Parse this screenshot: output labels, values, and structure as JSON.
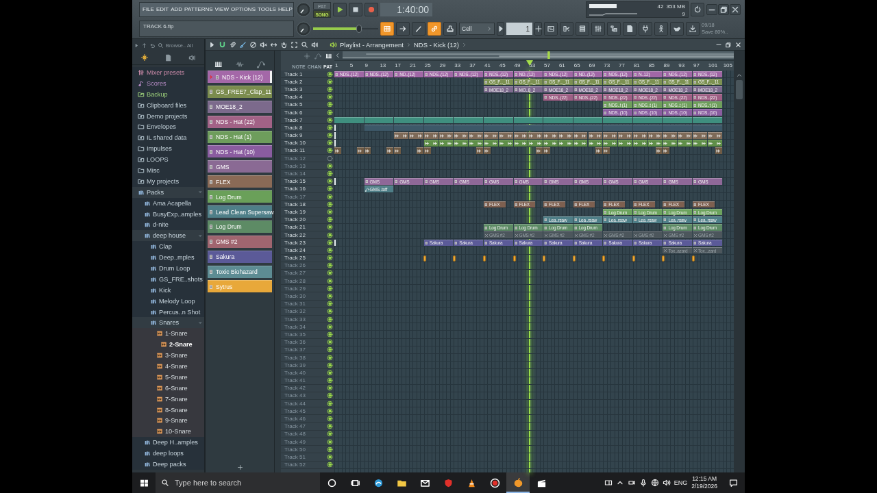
{
  "toolbar": {
    "menus": [
      "FILE",
      "EDIT",
      "ADD",
      "PATTERNS",
      "VIEW",
      "OPTIONS",
      "TOOLS",
      "HELP"
    ],
    "hint": "TRACK 6.flp",
    "modes": [
      {
        "label": "PAT",
        "selected": false
      },
      {
        "label": "SONG",
        "selected": true
      }
    ],
    "time": "1:40:00",
    "cpu": "42",
    "memory": "353 MB",
    "polyphony": "9",
    "master_volume": {
      "level": 0.7
    },
    "tools": [
      {
        "kind": "pattern",
        "on": true
      },
      {
        "kind": "arrow",
        "on": false
      },
      {
        "kind": "pen",
        "on": false
      },
      {
        "kind": "link",
        "on": true
      },
      {
        "kind": "stamp",
        "on": false
      }
    ],
    "snap": "Cell",
    "pattern": "1",
    "news": {
      "date": "09/18",
      "text": "Save 80%.."
    }
  },
  "browser": {
    "filter": "Browse.. All",
    "items": [
      {
        "label": "Mixer presets",
        "kind": "mixer",
        "selected": false
      },
      {
        "label": "Scores",
        "kind": "score",
        "selected": false
      },
      {
        "label": "Backup",
        "kind": "backup",
        "selected": false
      },
      {
        "label": "Clipboard files",
        "kind": "link-folder",
        "selected": false
      },
      {
        "label": "Demo projects",
        "kind": "link-folder",
        "selected": false
      },
      {
        "label": "Envelopes",
        "kind": "folder",
        "selected": false
      },
      {
        "label": "IL shared data",
        "kind": "link-folder",
        "selected": false
      },
      {
        "label": "Impulses",
        "kind": "folder",
        "selected": false
      },
      {
        "label": "LOOPS",
        "kind": "link-folder",
        "selected": false
      },
      {
        "label": "Misc",
        "kind": "folder",
        "selected": false
      },
      {
        "label": "My projects",
        "kind": "link-folder",
        "selected": false
      },
      {
        "label": "Packs",
        "kind": "pack",
        "selected": false,
        "expanded": true,
        "children": [
          {
            "label": "Ama Acapella",
            "kind": "pack",
            "selected": false
          },
          {
            "label": "BusyExp..amples",
            "kind": "pack",
            "selected": false
          },
          {
            "label": "d-nite",
            "kind": "pack",
            "selected": false
          },
          {
            "label": "deep house",
            "kind": "pack",
            "selected": false,
            "expanded": true,
            "children": [
              {
                "label": "Clap",
                "kind": "pack",
                "selected": false
              },
              {
                "label": "Deep..mples",
                "kind": "pack",
                "selected": false
              },
              {
                "label": "Drum Loop",
                "kind": "pack",
                "selected": false
              },
              {
                "label": "GS_FRE..shots",
                "kind": "pack",
                "selected": false
              },
              {
                "label": "Kick",
                "kind": "pack",
                "selected": false
              },
              {
                "label": "Melody Loop",
                "kind": "pack",
                "selected": false
              },
              {
                "label": "Percus..n Shot",
                "kind": "pack",
                "selected": false
              },
              {
                "label": "Snares",
                "kind": "pack",
                "selected": false,
                "expanded": true,
                "children": [
                  {
                    "label": "1-Snare",
                    "kind": "sample",
                    "selected": false
                  },
                  {
                    "label": "2-Snare",
                    "kind": "sample",
                    "selected": true
                  },
                  {
                    "label": "3-Snare",
                    "kind": "sample",
                    "selected": false
                  },
                  {
                    "label": "4-Snare",
                    "kind": "sample",
                    "selected": false
                  },
                  {
                    "label": "5-Snare",
                    "kind": "sample",
                    "selected": false
                  },
                  {
                    "label": "6-Snare",
                    "kind": "sample",
                    "selected": false
                  },
                  {
                    "label": "7-Snare",
                    "kind": "sample",
                    "selected": false
                  },
                  {
                    "label": "8-Snare",
                    "kind": "sample",
                    "selected": false
                  },
                  {
                    "label": "9-Snare",
                    "kind": "sample",
                    "selected": false
                  },
                  {
                    "label": "10-Snare",
                    "kind": "sample",
                    "selected": false
                  }
                ]
              }
            ]
          },
          {
            "label": "Deep H..amples",
            "kind": "pack",
            "selected": false
          },
          {
            "label": "deep loops",
            "kind": "pack",
            "selected": false
          },
          {
            "label": "Deep packs",
            "kind": "pack",
            "selected": false
          }
        ]
      }
    ]
  },
  "channels": [
    {
      "name": "NDS - Kick (12)",
      "color": "#a468a8",
      "selected": true
    },
    {
      "name": "GS_FREE7_Clap_11",
      "color": "#7b8c4e",
      "selected": false
    },
    {
      "name": "MOE18_2",
      "color": "#7c6a8c",
      "selected": false
    },
    {
      "name": "NDS - Hat (22)",
      "color": "#a26286",
      "selected": false
    },
    {
      "name": "NDS - Hat (1)",
      "color": "#6e9d5c",
      "selected": false
    },
    {
      "name": "NDS - Hat (10)",
      "color": "#8a5ca0",
      "selected": false
    },
    {
      "name": "GMS",
      "color": "#8a6a94",
      "selected": false
    },
    {
      "name": "FLEX",
      "color": "#8a6a56",
      "selected": false
    },
    {
      "name": "Log Drum",
      "color": "#6aa059",
      "selected": false
    },
    {
      "name": "Lead Clean Supersaw",
      "color": "#4f7f88",
      "selected": false
    },
    {
      "name": "Log Drum",
      "color": "#5d8b65",
      "selected": false
    },
    {
      "name": "GMS #2",
      "color": "#a0656f",
      "selected": false
    },
    {
      "name": "Sakura",
      "color": "#5b5a98",
      "selected": false
    },
    {
      "name": "Toxic Biohazard",
      "color": "#5d8c93",
      "selected": false
    },
    {
      "name": "Sytrus",
      "color": "#e8a83a",
      "selected": false
    }
  ],
  "playlist": {
    "title": "Playlist - Arrangement",
    "pattern": "NDS - Kick (12)",
    "columns": [
      {
        "label": "NOTE",
        "selected": false
      },
      {
        "label": "CHAN",
        "selected": false
      },
      {
        "label": "PAT",
        "selected": true
      }
    ],
    "ruler": [
      "1",
      "5",
      "9",
      "13",
      "17",
      "21",
      "25",
      "29",
      "33",
      "37",
      "41",
      "45",
      "49",
      "53",
      "57",
      "61",
      "65",
      "69",
      "73",
      "77",
      "81",
      "85",
      "89",
      "93",
      "97",
      "101",
      "105"
    ],
    "playhead": {
      "level": 0.488
    },
    "tracks": [
      {
        "name": "Track 1",
        "muted": false,
        "color": "#a067a6",
        "slots": [
          {
            "kind": "pattern",
            "label": "NDS..(12)"
          },
          {
            "kind": "pattern",
            "label": "NDS..(12)"
          },
          {
            "kind": "pattern",
            "label": "ND..(12)"
          },
          {
            "kind": "pattern",
            "label": "NDS..(12)"
          },
          {
            "kind": "pattern",
            "label": "NDS..(12)"
          },
          {
            "kind": "pattern",
            "label": "NDS..(12)"
          },
          {
            "kind": "pattern",
            "label": "ND..(12)"
          },
          {
            "kind": "pattern",
            "label": "NDS..(12)"
          },
          {
            "kind": "pattern",
            "label": "ND..(12)"
          },
          {
            "kind": "pattern",
            "label": "NDS..(12)"
          },
          {
            "kind": "pattern",
            "label": "N..12)"
          },
          {
            "kind": "pattern",
            "label": "NDS..(12)"
          },
          {
            "kind": "pattern",
            "label": "NDS..(12)"
          }
        ]
      },
      {
        "name": "Track 2",
        "muted": false,
        "color": "#7c9152",
        "slots": [
          {
            "kind": "gap"
          },
          {
            "kind": "gap"
          },
          {
            "kind": "gap"
          },
          {
            "kind": "gap"
          },
          {
            "kind": "gap"
          },
          {
            "kind": "pattern",
            "label": "GS_F..._11"
          },
          {
            "kind": "pattern",
            "label": "GS_F..._11"
          },
          {
            "kind": "pattern",
            "label": "GS_F..._11"
          },
          {
            "kind": "pattern",
            "label": "GS_F..._11"
          },
          {
            "kind": "pattern",
            "label": "GS_F..._11"
          },
          {
            "kind": "pattern",
            "label": "GS_F..._11"
          },
          {
            "kind": "pattern",
            "label": "GS_F..._11"
          },
          {
            "kind": "pattern",
            "label": "GS_F..._11"
          }
        ]
      },
      {
        "name": "Track 3",
        "muted": false,
        "color": "#7d6a8e",
        "slots": [
          {
            "kind": "gap"
          },
          {
            "kind": "gap"
          },
          {
            "kind": "gap"
          },
          {
            "kind": "gap"
          },
          {
            "kind": "gap"
          },
          {
            "kind": "pattern",
            "label": "MOE18_2"
          },
          {
            "kind": "pattern",
            "label": "MO..8_2"
          },
          {
            "kind": "pattern",
            "label": "MOE18_2"
          },
          {
            "kind": "pattern",
            "label": "MOE18_2"
          },
          {
            "kind": "pattern",
            "label": "MOE18_2"
          },
          {
            "kind": "pattern",
            "label": "MOE18_2"
          },
          {
            "kind": "pattern",
            "label": "MOE18_2"
          },
          {
            "kind": "pattern",
            "label": "MOE18_2"
          }
        ]
      },
      {
        "name": "Track 4",
        "muted": false,
        "color": "#9f5f85",
        "slots": [
          {
            "kind": "gap"
          },
          {
            "kind": "gap"
          },
          {
            "kind": "gap"
          },
          {
            "kind": "gap"
          },
          {
            "kind": "gap"
          },
          {
            "kind": "gap"
          },
          {
            "kind": "gap"
          },
          {
            "kind": "pattern",
            "label": "NDS..(22)"
          },
          {
            "kind": "pattern",
            "label": "NDS..(22)"
          },
          {
            "kind": "pattern",
            "label": "NDS..(22)"
          },
          {
            "kind": "pattern",
            "label": "NDS..(22)"
          },
          {
            "kind": "pattern",
            "label": "NDS..(22)"
          },
          {
            "kind": "pattern",
            "label": "NDS..(22)"
          }
        ]
      },
      {
        "name": "Track 5",
        "muted": false,
        "color": "#6f9f5c",
        "slots": [
          {
            "kind": "gap"
          },
          {
            "kind": "gap"
          },
          {
            "kind": "gap"
          },
          {
            "kind": "gap"
          },
          {
            "kind": "gap"
          },
          {
            "kind": "gap"
          },
          {
            "kind": "gap"
          },
          {
            "kind": "gap"
          },
          {
            "kind": "gap"
          },
          {
            "kind": "pattern",
            "label": "NDS..t (1)"
          },
          {
            "kind": "pattern",
            "label": "NDS..t (1)"
          },
          {
            "kind": "pattern",
            "label": "NDS..t (1)"
          },
          {
            "kind": "pattern",
            "label": "NDS..t (1)"
          }
        ]
      },
      {
        "name": "Track 6",
        "muted": false,
        "color": "#8a5da0",
        "slots": [
          {
            "kind": "gap"
          },
          {
            "kind": "gap"
          },
          {
            "kind": "gap"
          },
          {
            "kind": "gap"
          },
          {
            "kind": "gap"
          },
          {
            "kind": "gap"
          },
          {
            "kind": "gap"
          },
          {
            "kind": "gap"
          },
          {
            "kind": "gap"
          },
          {
            "kind": "pattern",
            "label": "NDS..(10)"
          },
          {
            "kind": "pattern",
            "label": "NDS..(10)"
          },
          {
            "kind": "pattern",
            "label": "NDS..(10)"
          },
          {
            "kind": "pattern",
            "label": "NDS..(10)"
          }
        ]
      },
      {
        "name": "Track 7",
        "muted": false,
        "color": "#3f8f7f",
        "slots": [
          {
            "kind": "strip"
          },
          {
            "kind": "strip"
          },
          {
            "kind": "strip"
          },
          {
            "kind": "strip"
          },
          {
            "kind": "strip"
          },
          {
            "kind": "strip"
          },
          {
            "kind": "strip"
          },
          {
            "kind": "strip"
          },
          {
            "kind": "strip"
          },
          {
            "kind": "strip"
          },
          {
            "kind": "strip"
          },
          {
            "kind": "strip"
          },
          {
            "kind": "strip"
          }
        ]
      },
      {
        "name": "Track 8",
        "muted": false,
        "color": "#3d5868",
        "slots": [
          {
            "kind": "marker"
          },
          {
            "kind": "bar"
          },
          {
            "kind": "bar"
          },
          {
            "kind": "bar"
          },
          {
            "kind": "bar"
          },
          {
            "kind": "bar"
          },
          {
            "kind": "bar"
          },
          {
            "kind": "bar"
          },
          {
            "kind": "bar"
          },
          {
            "kind": "bar"
          },
          {
            "kind": "bar"
          },
          {
            "kind": "bar"
          },
          {
            "kind": "bar"
          }
        ]
      },
      {
        "name": "Track 9",
        "muted": false,
        "color": "#7e6a58",
        "slots": [
          {
            "kind": "marker"
          },
          {
            "kind": "gap"
          },
          {
            "kind": "audio-pair"
          },
          {
            "kind": "audio-pair"
          },
          {
            "kind": "audio-pair"
          },
          {
            "kind": "audio-pair"
          },
          {
            "kind": "audio-pair"
          },
          {
            "kind": "audio-pair"
          },
          {
            "kind": "audio-pair"
          },
          {
            "kind": "audio-pair"
          },
          {
            "kind": "audio-pair"
          },
          {
            "kind": "audio-pair"
          },
          {
            "kind": "audio-pair"
          }
        ]
      },
      {
        "name": "Track 10",
        "muted": false,
        "color": "#5f8f48",
        "slots": [
          {
            "kind": "marker"
          },
          {
            "kind": "gap"
          },
          {
            "kind": "gap"
          },
          {
            "kind": "audio-pair"
          },
          {
            "kind": "audio-pair"
          },
          {
            "kind": "audio-pair"
          },
          {
            "kind": "audio-pair"
          },
          {
            "kind": "audio-pair"
          },
          {
            "kind": "audio-pair"
          },
          {
            "kind": "audio-pair"
          },
          {
            "kind": "audio-pair"
          },
          {
            "kind": "audio-pair"
          },
          {
            "kind": "audio-pair"
          }
        ]
      },
      {
        "name": "Track 11",
        "muted": false,
        "color": "#6f5b45",
        "slots": [
          {
            "kind": "audio-ends"
          },
          {
            "kind": "audio-ends"
          },
          {
            "kind": "audio-ends"
          },
          {
            "kind": "audio-start"
          },
          {
            "kind": "audio-end"
          },
          {
            "kind": "audio-start"
          },
          {
            "kind": "audio-end"
          },
          {
            "kind": "audio-start"
          },
          {
            "kind": "audio-end"
          },
          {
            "kind": "audio-start"
          },
          {
            "kind": "audio-end"
          },
          {
            "kind": "audio-start"
          },
          {
            "kind": "audio-end"
          }
        ]
      },
      {
        "name": "Track 12",
        "muted": true
      },
      {
        "name": "Track 13",
        "muted": false
      },
      {
        "name": "Track 14",
        "muted": false
      },
      {
        "name": "Track 15",
        "muted": false,
        "color": "#8f6898",
        "slots": [
          {
            "kind": "marker"
          },
          {
            "kind": "pattern",
            "label": "GMS"
          },
          {
            "kind": "pattern",
            "label": "GMS"
          },
          {
            "kind": "pattern",
            "label": "GMS"
          },
          {
            "kind": "pattern",
            "label": "GMS"
          },
          {
            "kind": "pattern",
            "label": "GMS"
          },
          {
            "kind": "pattern",
            "label": "GMS"
          },
          {
            "kind": "pattern",
            "label": "GMS"
          },
          {
            "kind": "pattern",
            "label": "GMS"
          },
          {
            "kind": "pattern",
            "label": "GMS"
          },
          {
            "kind": "pattern",
            "label": "GMS"
          },
          {
            "kind": "pattern",
            "label": "GMS"
          },
          {
            "kind": "pattern",
            "label": "GMS"
          }
        ]
      },
      {
        "name": "Track 16",
        "muted": false,
        "color": "#4f7f88",
        "slots": [
          {
            "kind": "gap"
          },
          {
            "kind": "automation",
            "label": "GMS..toff"
          }
        ]
      },
      {
        "name": "Track 17",
        "muted": false
      },
      {
        "name": "Track 18",
        "muted": false,
        "color": "#7e6050",
        "slots": [
          {
            "kind": "gap"
          },
          {
            "kind": "gap"
          },
          {
            "kind": "gap"
          },
          {
            "kind": "gap"
          },
          {
            "kind": "gap"
          },
          {
            "kind": "short-pattern",
            "label": "FLEX"
          },
          {
            "kind": "short-pattern",
            "label": "FLEX"
          },
          {
            "kind": "short-pattern",
            "label": "FLEX"
          },
          {
            "kind": "short-pattern",
            "label": "FLEX"
          },
          {
            "kind": "short-pattern",
            "label": "FLEX"
          },
          {
            "kind": "short-pattern",
            "label": "FLEX"
          },
          {
            "kind": "short-pattern",
            "label": "FLEX"
          },
          {
            "kind": "short-pattern",
            "label": "FLEX"
          }
        ]
      },
      {
        "name": "Track 19",
        "muted": false,
        "color": "#6da35e",
        "slots": [
          {
            "kind": "gap"
          },
          {
            "kind": "gap"
          },
          {
            "kind": "gap"
          },
          {
            "kind": "gap"
          },
          {
            "kind": "gap"
          },
          {
            "kind": "gap"
          },
          {
            "kind": "gap"
          },
          {
            "kind": "gap"
          },
          {
            "kind": "gap"
          },
          {
            "kind": "pattern",
            "label": "Log Drum"
          },
          {
            "kind": "pattern",
            "label": "Log Drum"
          },
          {
            "kind": "pattern",
            "label": "Log Drum"
          },
          {
            "kind": "pattern",
            "label": "Log Drum"
          }
        ]
      },
      {
        "name": "Track 20",
        "muted": false,
        "color": "#4f7f88",
        "slots": [
          {
            "kind": "gap"
          },
          {
            "kind": "gap"
          },
          {
            "kind": "gap"
          },
          {
            "kind": "gap"
          },
          {
            "kind": "gap"
          },
          {
            "kind": "gap"
          },
          {
            "kind": "gap"
          },
          {
            "kind": "pattern",
            "label": "Lea..rsaw"
          },
          {
            "kind": "pattern",
            "label": "Lea..rsaw"
          },
          {
            "kind": "pattern",
            "label": "Lea..rsaw"
          },
          {
            "kind": "pattern",
            "label": "Lea..rsaw"
          },
          {
            "kind": "pattern",
            "label": "Lea..rsaw"
          },
          {
            "kind": "pattern",
            "label": "Lea..rsaw"
          }
        ]
      },
      {
        "name": "Track 21",
        "muted": false,
        "color": "#5d8b65",
        "slots": [
          {
            "kind": "gap"
          },
          {
            "kind": "gap"
          },
          {
            "kind": "gap"
          },
          {
            "kind": "gap"
          },
          {
            "kind": "gap"
          },
          {
            "kind": "pattern",
            "label": "Log Drum"
          },
          {
            "kind": "pattern",
            "label": "Log Drum"
          },
          {
            "kind": "pattern",
            "label": "Log Drum"
          },
          {
            "kind": "pattern",
            "label": "Log Drum"
          },
          {
            "kind": "gap"
          },
          {
            "kind": "gap"
          },
          {
            "kind": "pattern",
            "label": "Log Drum"
          },
          {
            "kind": "pattern",
            "label": "Log Drum"
          }
        ]
      },
      {
        "name": "Track 22",
        "muted": false,
        "color": "#4c565c",
        "slots": [
          {
            "kind": "gap"
          },
          {
            "kind": "gap"
          },
          {
            "kind": "gap"
          },
          {
            "kind": "gap"
          },
          {
            "kind": "gap"
          },
          {
            "kind": "muted",
            "label": "GMS #2"
          },
          {
            "kind": "muted",
            "label": "GMS #2"
          },
          {
            "kind": "muted",
            "label": "GMS #2"
          },
          {
            "kind": "muted",
            "label": "GMS #2"
          },
          {
            "kind": "muted",
            "label": "GMS #2"
          },
          {
            "kind": "muted",
            "label": "GMS #2"
          },
          {
            "kind": "muted",
            "label": "GMS #2"
          },
          {
            "kind": "muted",
            "label": "GMS #2"
          }
        ]
      },
      {
        "name": "Track 23",
        "muted": false,
        "color": "#5b5a98",
        "slots": [
          {
            "kind": "marker"
          },
          {
            "kind": "gap"
          },
          {
            "kind": "gap"
          },
          {
            "kind": "pattern",
            "label": "Sakura"
          },
          {
            "kind": "pattern",
            "label": "Sakura"
          },
          {
            "kind": "pattern",
            "label": "Sakura"
          },
          {
            "kind": "pattern",
            "label": "Sakura"
          },
          {
            "kind": "pattern",
            "label": "Sakura"
          },
          {
            "kind": "pattern",
            "label": "Sakura"
          },
          {
            "kind": "pattern",
            "label": "Sakura"
          },
          {
            "kind": "pattern",
            "label": "Sakura"
          },
          {
            "kind": "pattern",
            "label": "Sakura"
          },
          {
            "kind": "pattern",
            "label": "Sakura"
          }
        ]
      },
      {
        "name": "Track 24",
        "muted": false,
        "color": "#4c565c",
        "slots": [
          {
            "kind": "gap"
          },
          {
            "kind": "gap"
          },
          {
            "kind": "gap"
          },
          {
            "kind": "gap"
          },
          {
            "kind": "gap"
          },
          {
            "kind": "gap"
          },
          {
            "kind": "gap"
          },
          {
            "kind": "gap"
          },
          {
            "kind": "gap"
          },
          {
            "kind": "gap"
          },
          {
            "kind": "gap"
          },
          {
            "kind": "muted",
            "label": "Tox..azard"
          },
          {
            "kind": "muted",
            "label": "Tox...zard"
          }
        ]
      },
      {
        "name": "Track 25",
        "muted": false,
        "color": "#e8a83a",
        "slots": [
          {
            "kind": "gap"
          },
          {
            "kind": "gap"
          },
          {
            "kind": "gap"
          },
          {
            "kind": "block"
          },
          {
            "kind": "block"
          },
          {
            "kind": "block"
          },
          {
            "kind": "block"
          },
          {
            "kind": "block"
          },
          {
            "kind": "block"
          },
          {
            "kind": "block"
          },
          {
            "kind": "block"
          },
          {
            "kind": "block"
          },
          {
            "kind": "block"
          }
        ]
      },
      {
        "name": "Track 26",
        "muted": false
      },
      {
        "name": "Track 27",
        "muted": false
      },
      {
        "name": "Track 28",
        "muted": false
      },
      {
        "name": "Track 29",
        "muted": false
      },
      {
        "name": "Track 30",
        "muted": false
      },
      {
        "name": "Track 31",
        "muted": false
      },
      {
        "name": "Track 32",
        "muted": false
      },
      {
        "name": "Track 33",
        "muted": false
      },
      {
        "name": "Track 34",
        "muted": false
      },
      {
        "name": "Track 35",
        "muted": false
      },
      {
        "name": "Track 36",
        "muted": false
      },
      {
        "name": "Track 37",
        "muted": false
      },
      {
        "name": "Track 38",
        "muted": false
      },
      {
        "name": "Track 39",
        "muted": false
      },
      {
        "name": "Track 40",
        "muted": false
      },
      {
        "name": "Track 41",
        "muted": false
      },
      {
        "name": "Track 42",
        "muted": false
      },
      {
        "name": "Track 43",
        "muted": false
      },
      {
        "name": "Track 44",
        "muted": false
      },
      {
        "name": "Track 45",
        "muted": false
      },
      {
        "name": "Track 46",
        "muted": false
      },
      {
        "name": "Track 47",
        "muted": false
      },
      {
        "name": "Track 48",
        "muted": false
      },
      {
        "name": "Track 49",
        "muted": false
      },
      {
        "name": "Track 50",
        "muted": false
      },
      {
        "name": "Track 51",
        "muted": false
      },
      {
        "name": "Track 52",
        "muted": false
      }
    ]
  },
  "taskbar": {
    "search": {
      "placeholder": "Type here to search"
    },
    "language": "ENG",
    "time": "12:15 AM",
    "date": "2/19/2026"
  }
}
